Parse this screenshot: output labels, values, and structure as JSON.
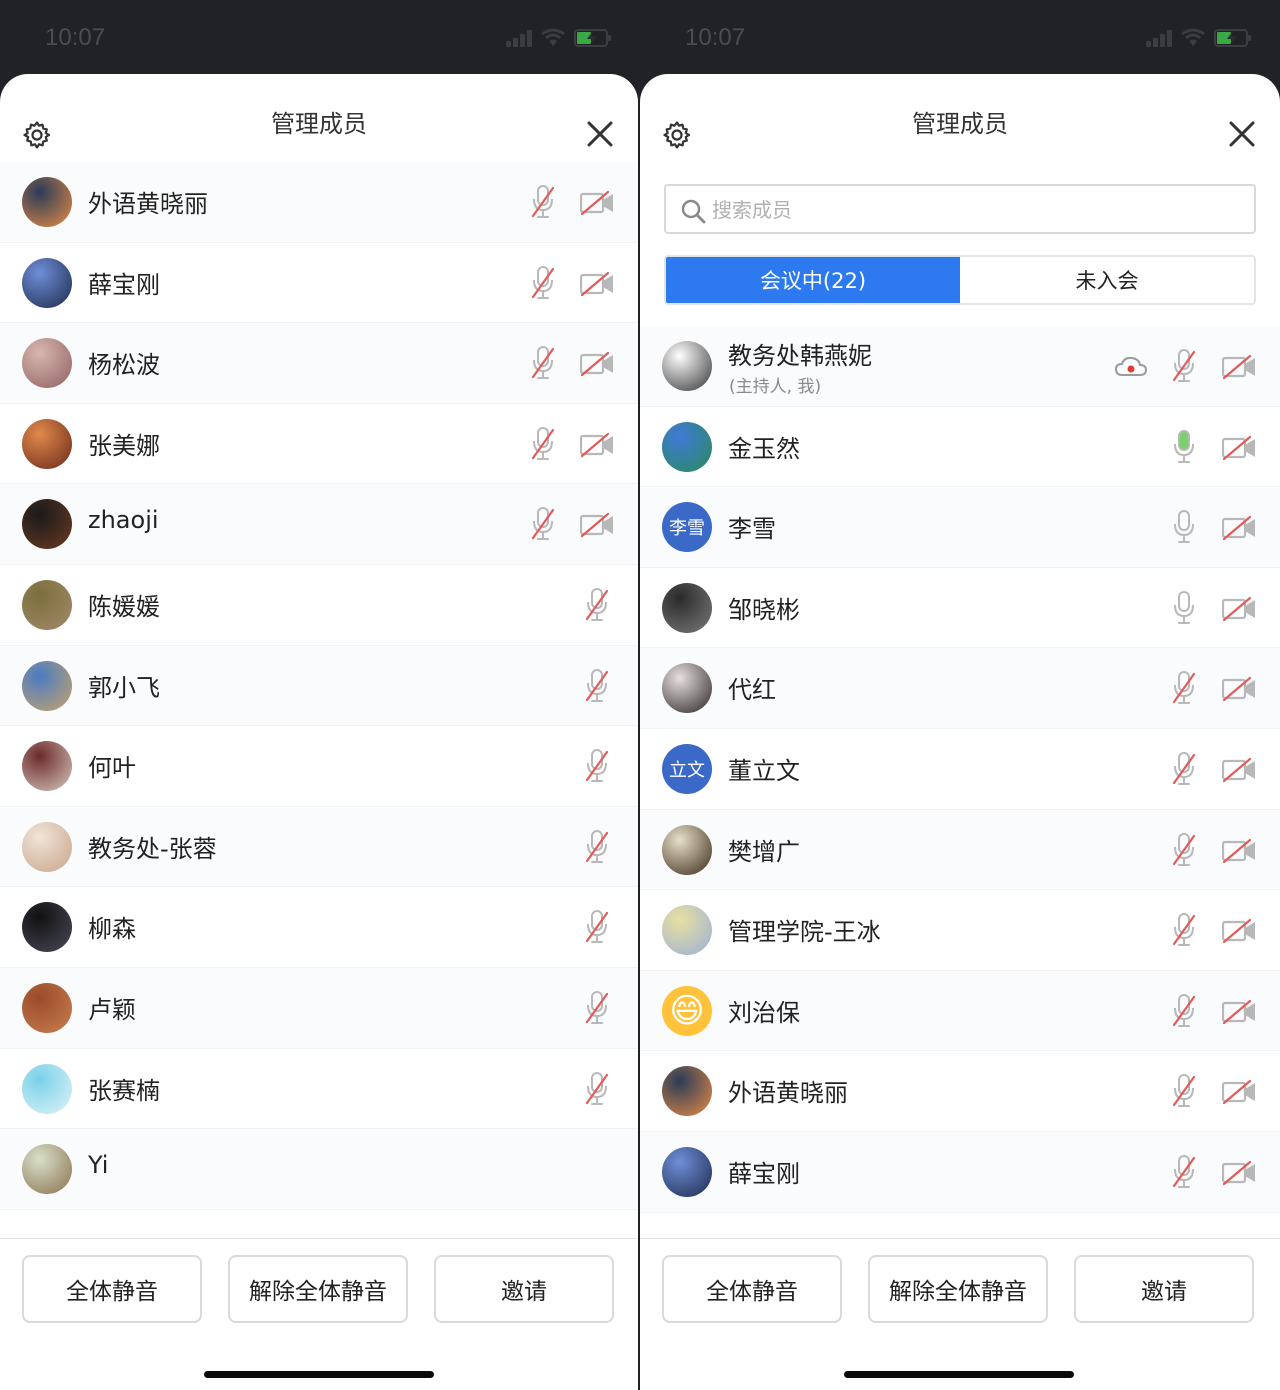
{
  "left": {
    "status_time": "10:07",
    "title": "管理成员",
    "members": [
      {
        "name": "外语黄晓丽",
        "avatar": "photo",
        "avatar_colors": [
          "#2a3b58",
          "#e78c44"
        ],
        "mic": "muted",
        "video": "off"
      },
      {
        "name": "薛宝刚",
        "avatar": "photo",
        "avatar_colors": [
          "#6f8fd8",
          "#1d2a4c"
        ],
        "mic": "muted",
        "video": "off"
      },
      {
        "name": "杨松波",
        "avatar": "photo",
        "avatar_colors": [
          "#d8b7b0",
          "#8f6060"
        ],
        "mic": "muted",
        "video": "off"
      },
      {
        "name": "张美娜",
        "avatar": "photo",
        "avatar_colors": [
          "#e0894b",
          "#6a2a1a"
        ],
        "mic": "muted",
        "video": "off"
      },
      {
        "name": "zhaoji",
        "avatar": "photo",
        "avatar_colors": [
          "#1a1a1a",
          "#6a3a22"
        ],
        "mic": "muted",
        "video": "off"
      },
      {
        "name": "陈媛媛",
        "avatar": "photo",
        "avatar_colors": [
          "#7b6f3d",
          "#a28a6a"
        ],
        "mic": "muted",
        "video": "none"
      },
      {
        "name": "郭小飞",
        "avatar": "photo",
        "avatar_colors": [
          "#4a7bc4",
          "#c8a46a"
        ],
        "mic": "muted",
        "video": "none"
      },
      {
        "name": "何叶",
        "avatar": "photo",
        "avatar_colors": [
          "#6b2a2a",
          "#d8c8c0"
        ],
        "mic": "muted",
        "video": "none"
      },
      {
        "name": "教务处-张蓉",
        "avatar": "photo",
        "avatar_colors": [
          "#f0e4d8",
          "#c8a48a"
        ],
        "mic": "muted",
        "video": "none"
      },
      {
        "name": "柳森",
        "avatar": "photo",
        "avatar_colors": [
          "#111",
          "#4a4a58"
        ],
        "mic": "muted",
        "video": "none"
      },
      {
        "name": "卢颖",
        "avatar": "photo",
        "avatar_colors": [
          "#9a4a2a",
          "#c88050"
        ],
        "mic": "muted",
        "video": "none"
      },
      {
        "name": "张赛楠",
        "avatar": "photo",
        "avatar_colors": [
          "#7ad0e8",
          "#e0f4f8"
        ],
        "mic": "muted",
        "video": "none"
      },
      {
        "name": "Yi",
        "avatar": "photo",
        "avatar_colors": [
          "#d8e0c8",
          "#8a7050"
        ],
        "mic": "none",
        "video": "none"
      }
    ],
    "buttons": {
      "mute_all": "全体静音",
      "unmute_all": "解除全体静音",
      "invite": "邀请"
    }
  },
  "right": {
    "status_time": "10:07",
    "title": "管理成员",
    "search_placeholder": "搜索成员",
    "tabs": {
      "in_meeting": "会议中(22)",
      "not_joined": "未入会"
    },
    "members": [
      {
        "name": "教务处韩燕妮",
        "sub": "(主持人, 我)",
        "avatar": "photo",
        "avatar_colors": [
          "#ffffff",
          "#333333"
        ],
        "cloud": true,
        "mic": "muted",
        "video": "off"
      },
      {
        "name": "金玉然",
        "avatar": "photo",
        "avatar_colors": [
          "#3f7ad8",
          "#2a8a5a"
        ],
        "mic": "active",
        "video": "off"
      },
      {
        "name": "李雪",
        "avatar": "text",
        "avatar_text": "李雪",
        "avatar_colors": [
          "#3b69c7",
          "#3b69c7"
        ],
        "mic": "on",
        "video": "off"
      },
      {
        "name": "邹晓彬",
        "avatar": "photo",
        "avatar_colors": [
          "#2a2a2a",
          "#7a7a7a"
        ],
        "mic": "on",
        "video": "off"
      },
      {
        "name": "代红",
        "avatar": "photo",
        "avatar_colors": [
          "#e8e0e0",
          "#2a2424"
        ],
        "mic": "muted",
        "video": "off"
      },
      {
        "name": "董立文",
        "avatar": "text",
        "avatar_text": "立文",
        "avatar_colors": [
          "#3b69c7",
          "#3b69c7"
        ],
        "mic": "muted",
        "video": "off"
      },
      {
        "name": "樊增广",
        "avatar": "photo",
        "avatar_colors": [
          "#e8e0c8",
          "#3a2a18"
        ],
        "mic": "muted",
        "video": "off"
      },
      {
        "name": "管理学院-王冰",
        "avatar": "photo",
        "avatar_colors": [
          "#e8e0a0",
          "#9ab0d8"
        ],
        "mic": "muted",
        "video": "off"
      },
      {
        "name": "刘治保",
        "avatar": "emoji",
        "avatar_text": "😄",
        "avatar_colors": [
          "#ffc23a",
          "#f0a020"
        ],
        "mic": "muted",
        "video": "off"
      },
      {
        "name": "外语黄晓丽",
        "avatar": "photo",
        "avatar_colors": [
          "#2a3b58",
          "#e78c44"
        ],
        "mic": "muted",
        "video": "off"
      },
      {
        "name": "薛宝刚",
        "avatar": "photo",
        "avatar_colors": [
          "#6f8fd8",
          "#1d2a4c"
        ],
        "mic": "muted",
        "video": "off"
      }
    ],
    "buttons": {
      "mute_all": "全体静音",
      "unmute_all": "解除全体静音",
      "invite": "邀请"
    }
  },
  "colors": {
    "accent": "#2d7af0",
    "muted_slash": "#e35a5a",
    "mic_active": "#7ad36a",
    "icon_gray": "#b8b8b8"
  }
}
